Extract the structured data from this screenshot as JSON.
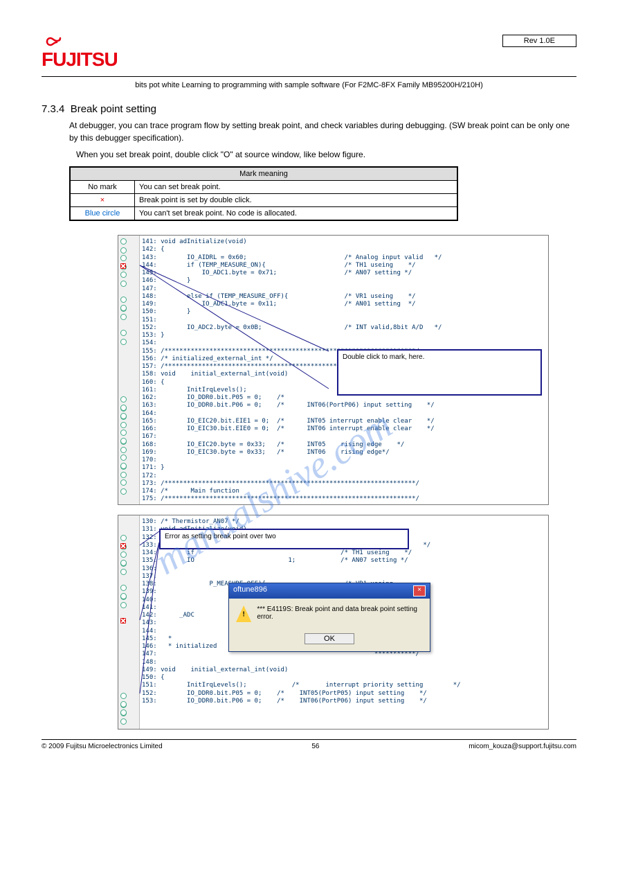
{
  "header": {
    "logo_text": "FUJITSU",
    "rev": "Rev 1.0E"
  },
  "doc_title": "bits pot white Learning to programming with sample software (For F2MC-8FX Family MB95200H/210H)",
  "section": {
    "num": "7.3.4",
    "heading": "Break point setting",
    "p1": "At debugger, you can trace program flow by setting break point, and check variables during debugging. (SW break point can be only one by this debugger specification).",
    "p2": "When you set break point, double click \"O\" at source window, like below figure.",
    "table": {
      "header": "Mark meaning",
      "rows": [
        [
          "No mark",
          "You can set break point."
        ],
        [
          "×",
          "Break point is set by double click."
        ],
        [
          "Blue circle",
          "You can't set break point. No code is allocated."
        ]
      ]
    }
  },
  "code1": {
    "lines": [
      "141: void adInitialize(void)",
      "142: {",
      "143:        IO_AIDRL = 0x60;                          /* Analog input valid   */",
      "144:        if (TEMP_MEASURE_ON){                     /* TH1 useing    */",
      "145:            IO_ADC1.byte = 0x71;                  /* AN07 setting */",
      "146:        }",
      "147:",
      "148:        else if (TEMP_MEASURE_OFF){               /* VR1 useing    */",
      "149:            IO_ADC1.byte = 0x11;                  /* AN01 setting  */",
      "150:        }",
      "151:",
      "152:        IO_ADC2.byte = 0x0B;                      /* INT valid,8bit A/D   */",
      "153: }",
      "154:",
      "155: /*******************************************************************/",
      "156: /* initialized_external_int */",
      "157: /*******************************************************************/",
      "158: void    initial_external_int(void)",
      "160: {",
      "161:        InitIrqLevels();",
      "162:        IO_DDR0.bit.P05 = 0;    /*",
      "163:        IO_DDR0.bit.P06 = 0;    /*      INT06(PortP06) input setting    */",
      "164:",
      "165:        IO_EIC20.bit.EIE1 = 0;  /*      INT05 interrupt enable clear    */",
      "166:        IO_EIC30.bit.EIE0 = 0;  /*      INT06 interrupt enable clear    */",
      "167:",
      "168:        IO_EIC20.byte = 0x33;   /*      INT05    rising edge    */",
      "169:        IO_EIC30.byte = 0x33;   /*      INT06    rising edge*/",
      "170:",
      "171: }",
      "172:",
      "173: /*******************************************************************/",
      "174: /*      Main function",
      "175: /*******************************************************************/"
    ],
    "callout": "Double click to mark, here."
  },
  "code2": {
    "lines": [
      "130: /* Thermistor_AN07 */",
      "131: void adInitialize(void)",
      "132: {",
      "133:                                                         nput valid    */",
      "134:        if                                       /* TH1 useing    */",
      "135:        IO                         1;            /* AN07 setting */",
      "136:        ",
      "137:",
      "138:              P_MEASURE_OFF){                     /* VR1 useing",
      "139:                           1;",
      "140:        ",
      "141:",
      "142:      _ADC                                                 A/D    */",
      "143:   ",
      "144:",
      "145:   *                                                      ***********/",
      "146:   * initialized                                                    ",
      "147:                                                          ***********/",
      "148:",
      "149: void    initial_external_int(void)",
      "150: {",
      "151:        InitIrqLevels();            /*       interrupt priority setting        */",
      "152:        IO_DDR0.bit.P05 = 0;    /*    INT05(PortP05) input setting    */",
      "153:        IO_DDR0.bit.P06 = 0;    /*    INT06(PortP06) input setting    */"
    ],
    "callout": "Error as setting break point over two",
    "dialog": {
      "title": "   oftune896",
      "msg": "*** E4119S: Break point and data break point setting error.",
      "ok": "OK"
    }
  },
  "watermark": "manualshive.com",
  "footer": {
    "copyright": "© 2009 Fujitsu Microelectronics Limited",
    "page": "56",
    "site": "micom_kouza@support.fujitsu.com"
  }
}
